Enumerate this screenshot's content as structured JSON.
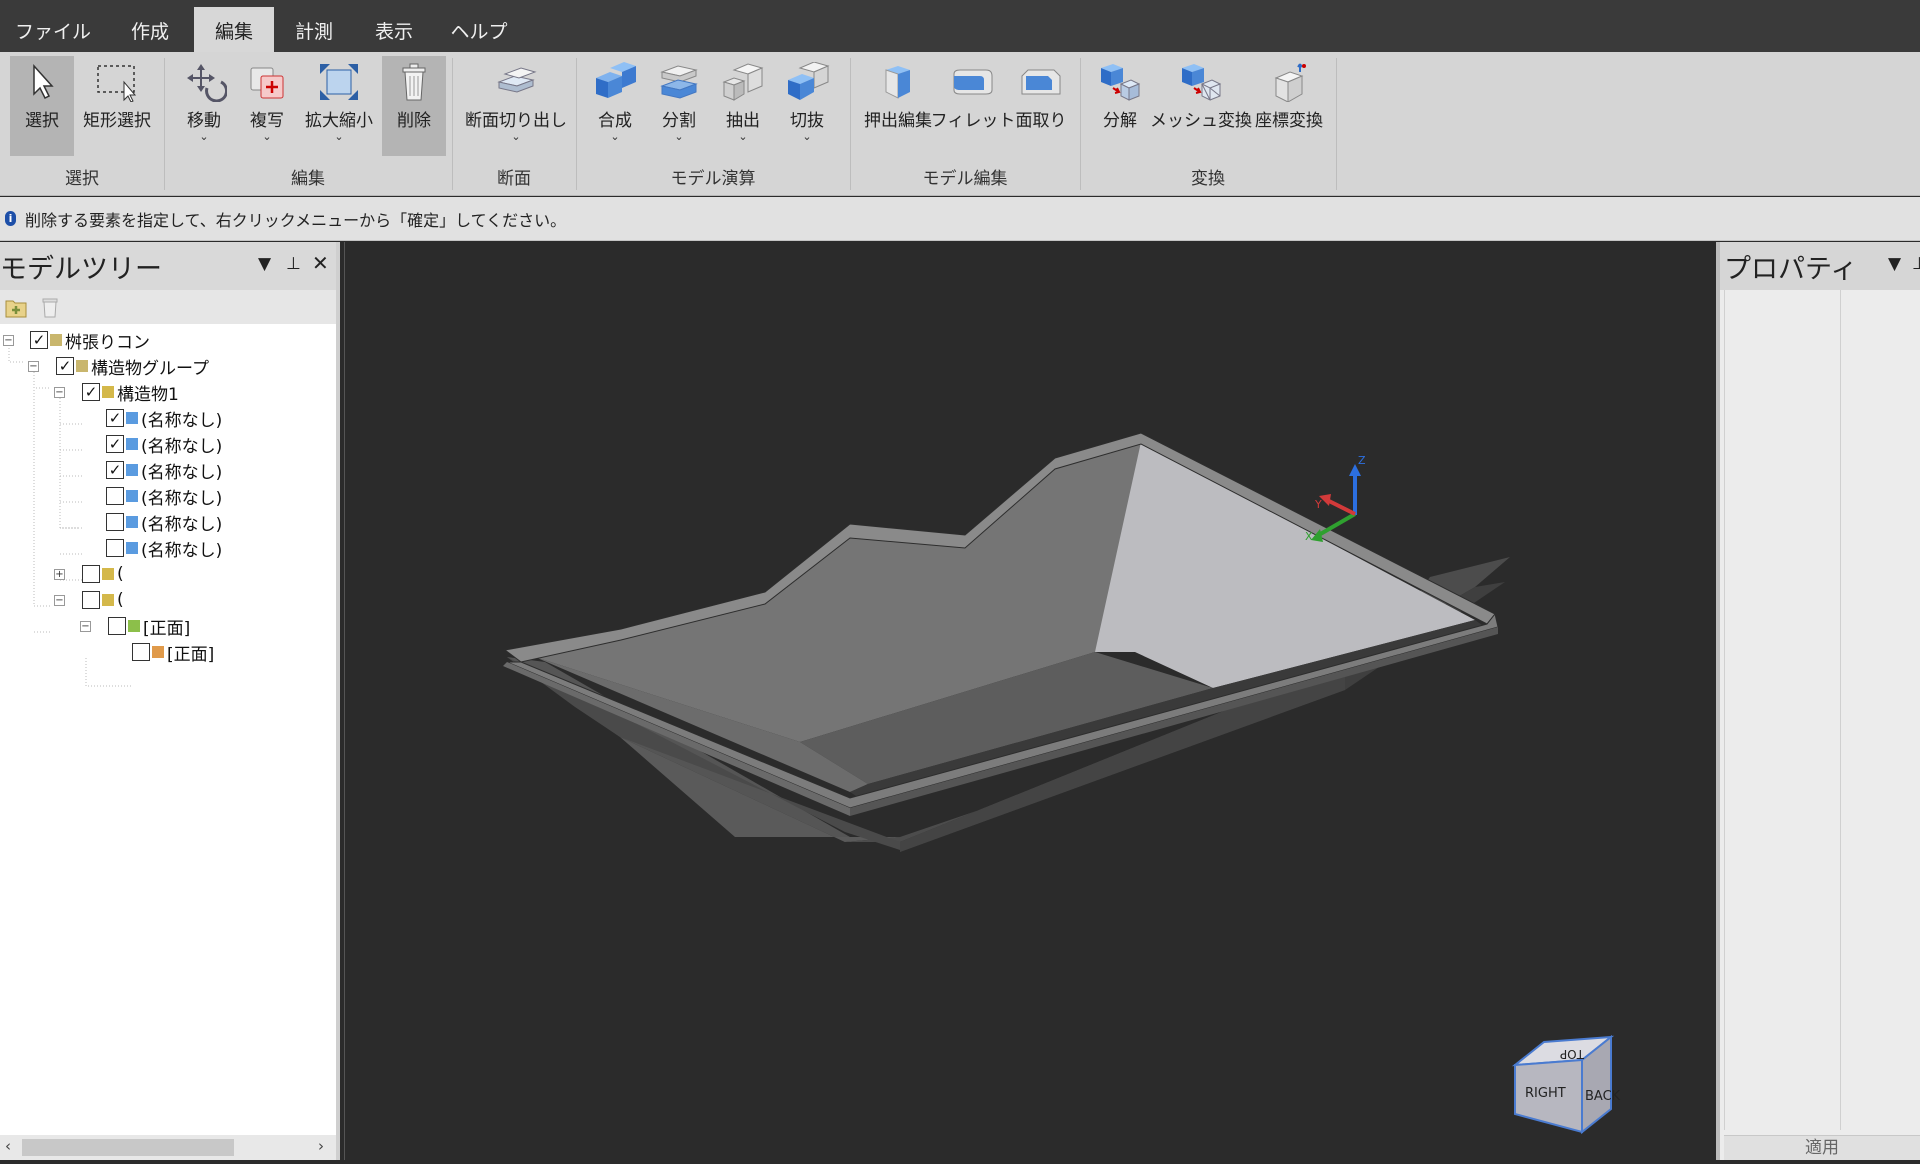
{
  "tabs": [
    "ファイル",
    "作成",
    "編集",
    "計測",
    "表示",
    "ヘルプ"
  ],
  "active_tab": "編集",
  "ribbon": {
    "groups": [
      {
        "label": "選択",
        "buttons": [
          "選択",
          "矩形選択"
        ]
      },
      {
        "label": "編集",
        "buttons": [
          "移動",
          "複写",
          "拡大縮小",
          "削除"
        ]
      },
      {
        "label": "断面",
        "buttons": [
          "断面切り出し"
        ]
      },
      {
        "label": "モデル演算",
        "buttons": [
          "合成",
          "分割",
          "抽出",
          "切抜"
        ]
      },
      {
        "label": "モデル編集",
        "buttons": [
          "押出編集",
          "フィレット",
          "面取り"
        ]
      },
      {
        "label": "変換",
        "buttons": [
          "分解",
          "メッシュ変換",
          "座標変換"
        ]
      }
    ],
    "selected_buttons": [
      "選択",
      "削除"
    ]
  },
  "info_message": "削除する要素を指定して、右クリックメニューから「確定」してください。",
  "model_tree": {
    "title": "モデルツリー",
    "items": [
      {
        "label": "桝張りコン",
        "checked": true
      },
      {
        "label": "構造物グループ",
        "checked": true
      },
      {
        "label": "構造物1",
        "checked": true
      },
      {
        "label": "(名称なし)",
        "checked": true
      },
      {
        "label": "(名称なし)",
        "checked": true
      },
      {
        "label": "(名称なし)",
        "checked": true
      },
      {
        "label": "(名称なし)",
        "checked": false
      },
      {
        "label": "(名称なし)",
        "checked": false
      },
      {
        "label": "(名称なし)",
        "checked": false
      },
      {
        "label": "(",
        "checked": false
      },
      {
        "label": "(",
        "checked": false
      },
      {
        "label": "[正面]",
        "checked": false
      },
      {
        "label": "[正面]",
        "checked": false
      }
    ]
  },
  "axes": {
    "x": "X",
    "y": "Y",
    "z": "Z"
  },
  "view_cube": {
    "top": "TOP",
    "right": "RIGHT",
    "back": "BACK"
  },
  "properties": {
    "title": "プロパティ",
    "apply_label": "適用"
  }
}
